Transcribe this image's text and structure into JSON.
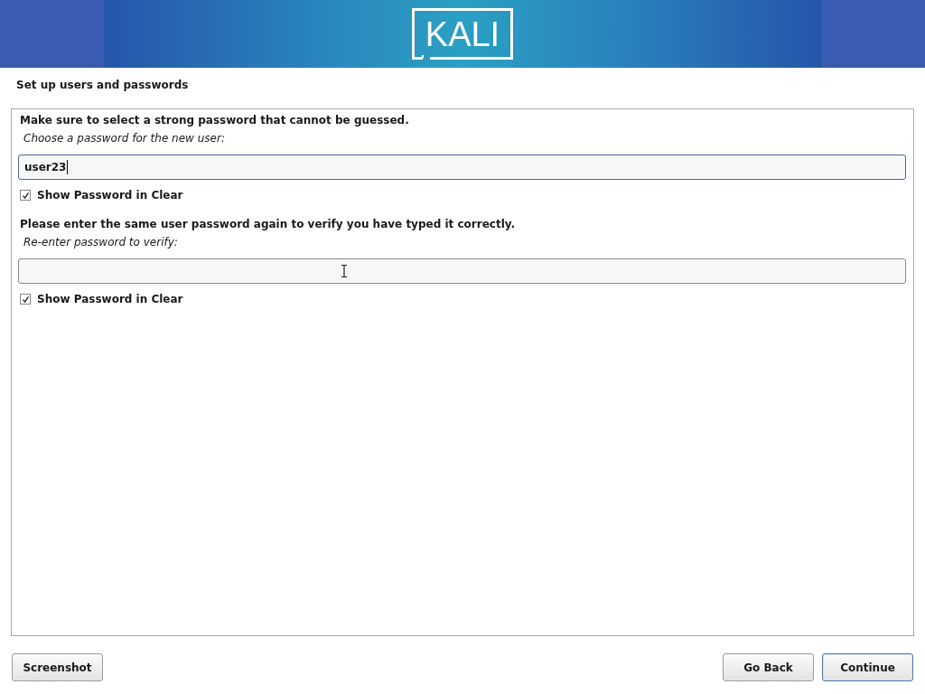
{
  "banner": {
    "logo": "KALI"
  },
  "page_title": "Set up users and passwords",
  "sections": [
    {
      "heading": "Make sure to select a strong password that cannot be guessed.",
      "prompt": "Choose a password for the new user:",
      "field": {
        "value": "user23",
        "focused": true
      },
      "show_password": {
        "label": "Show Password in Clear",
        "checked": true
      }
    },
    {
      "heading": "Please enter the same user password again to verify you have typed it correctly.",
      "prompt": "Re-enter password to verify:",
      "field": {
        "focused": false
      },
      "show_password": {
        "label": "Show Password in Clear",
        "checked": true
      }
    }
  ],
  "footer": {
    "left_buttons": [
      {
        "label": "Screenshot",
        "default": false
      }
    ],
    "right_buttons": [
      {
        "label": "Go Back",
        "default": false
      },
      {
        "label": "Continue",
        "default": true
      }
    ]
  }
}
